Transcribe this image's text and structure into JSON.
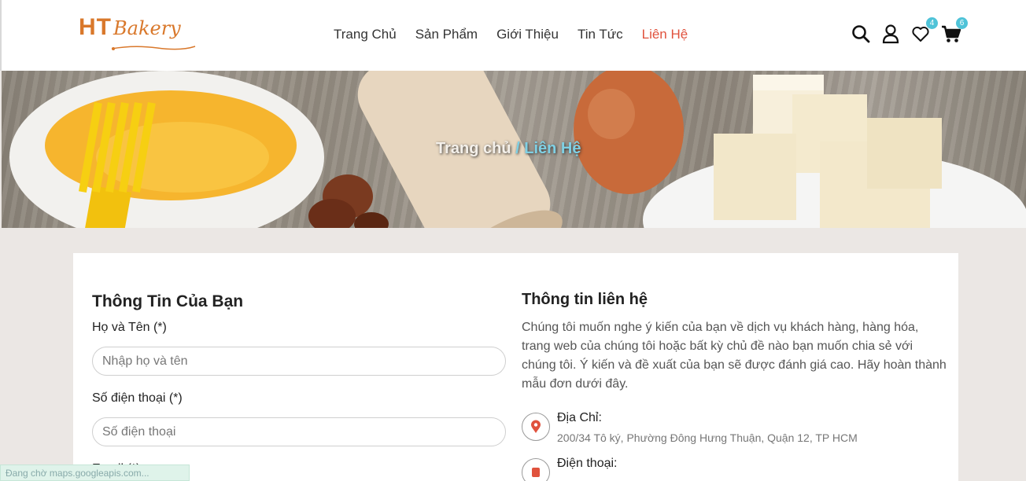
{
  "brand": {
    "name_a": "HT",
    "name_b": "Bakery",
    "color": "#d9782b"
  },
  "nav": {
    "items": [
      {
        "label": "Trang Chủ"
      },
      {
        "label": "Sản Phẩm"
      },
      {
        "label": "Giới Thiệu"
      },
      {
        "label": "Tin Tức"
      },
      {
        "label": "Liên Hệ"
      }
    ],
    "active_color": "#e0523d"
  },
  "header_icons": {
    "search": "search-icon",
    "user": "user-icon",
    "wishlist": "heart-icon",
    "wishlist_count": "4",
    "cart": "cart-icon",
    "cart_count": "6"
  },
  "breadcrumb": {
    "home": "Trang chủ",
    "sep": "/",
    "current": "Liên Hệ"
  },
  "form": {
    "title": "Thông Tin Của Bạn",
    "name_label": "Họ và Tên (*)",
    "name_placeholder": "Nhập họ và tên",
    "phone_label": "Số điện thoại (*)",
    "phone_placeholder": "Số điện thoại",
    "email_label": "Email (*)"
  },
  "contact": {
    "title": "Thông tin liên hệ",
    "description": "Chúng tôi muốn nghe ý kiến của bạn về dịch vụ khách hàng, hàng hóa, trang web của chúng tôi hoặc bất kỳ chủ đề nào bạn muốn chia sẻ với chúng tôi. Ý kiến và đề xuất của bạn sẽ được đánh giá cao. Hãy hoàn thành mẫu đơn dưới đây.",
    "address_label": "Địa Chỉ:",
    "address_value": "200/34 Tô ký, Phường Đông Hưng Thuận, Quận 12, TP HCM",
    "phone_label": "Điện thoại:"
  },
  "status_bar": "Đang chờ maps.googleapis.com..."
}
